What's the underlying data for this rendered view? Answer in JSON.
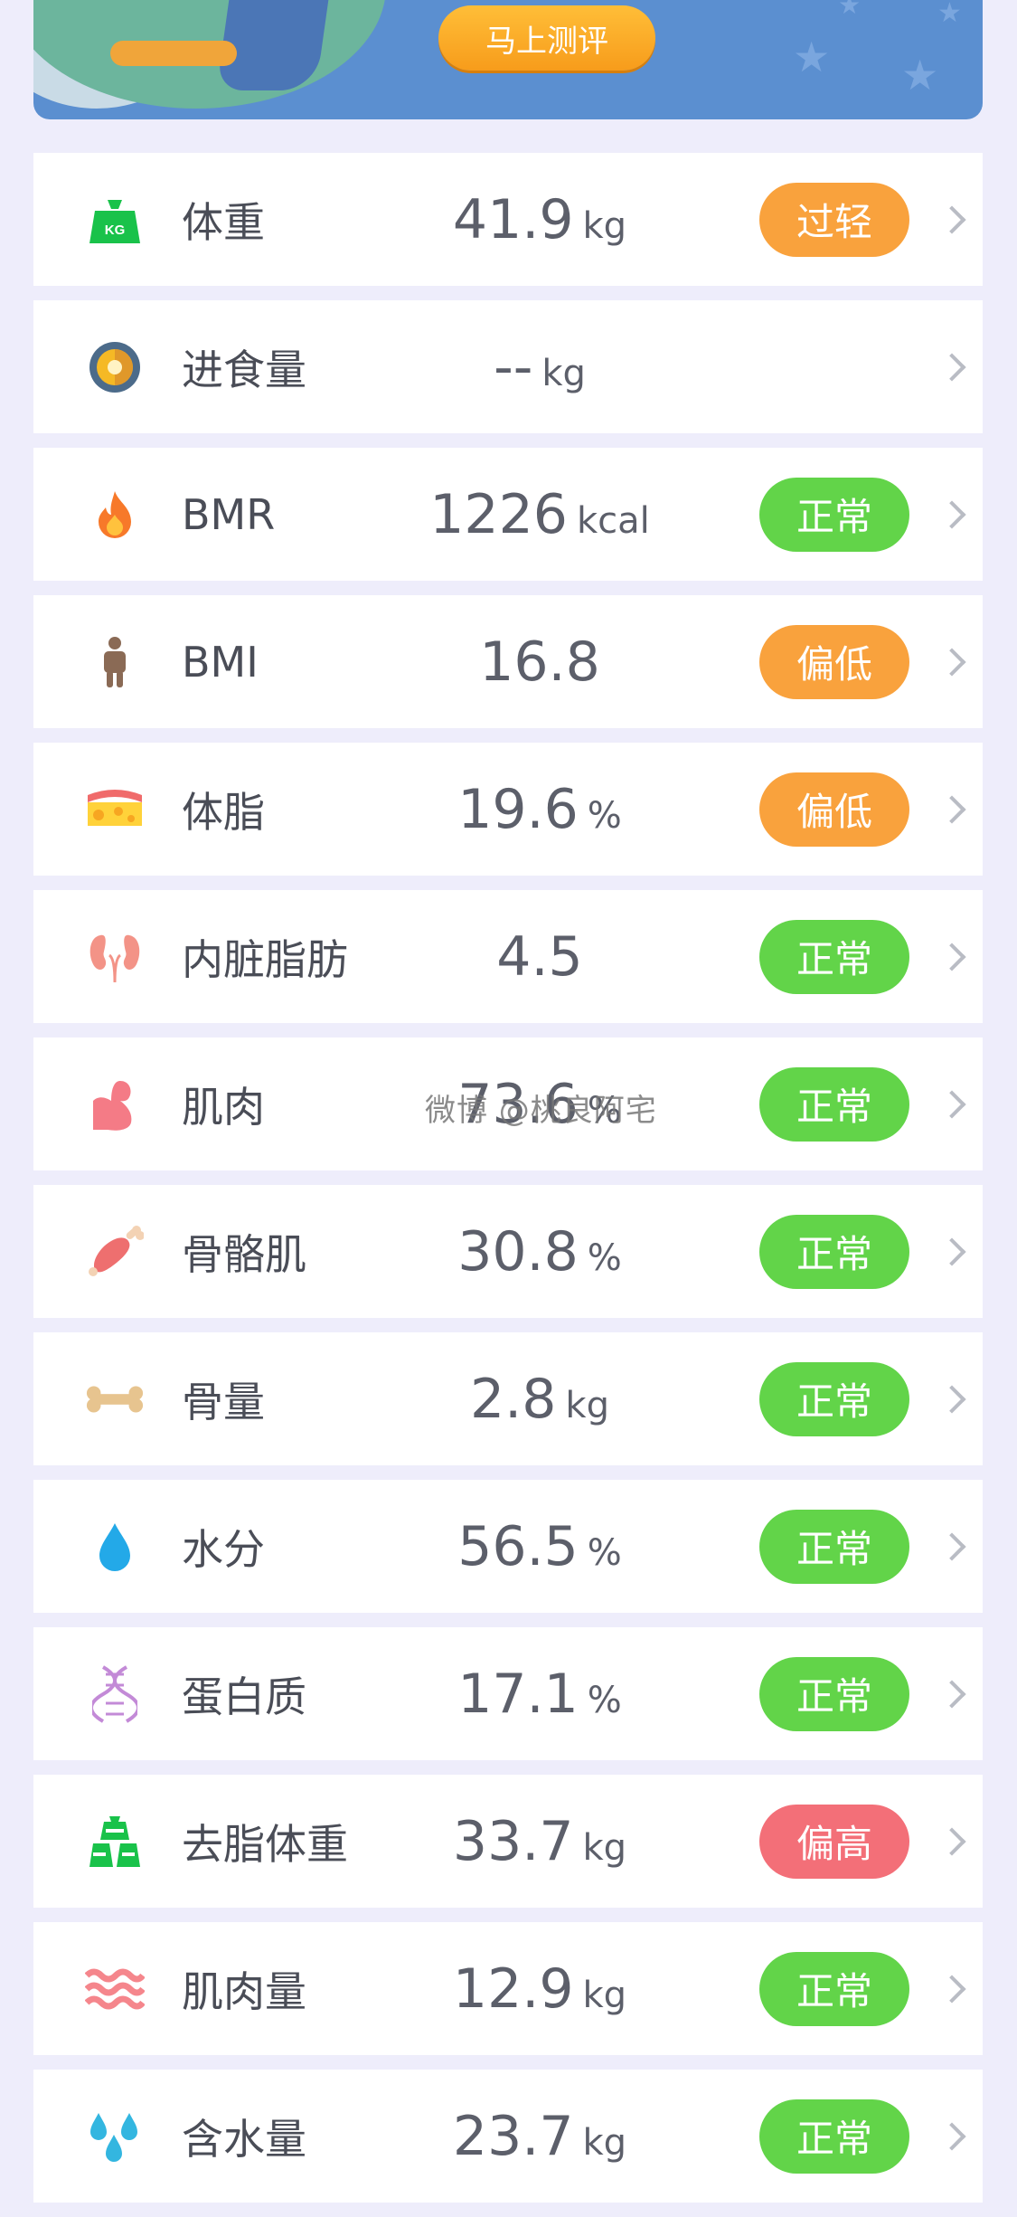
{
  "banner": {
    "button_label": "马上测评"
  },
  "colors": {
    "orange": "#f9a23d",
    "green": "#62d449",
    "red": "#f36f78"
  },
  "metrics": [
    {
      "label": "体重",
      "value": "41.9",
      "unit": "kg",
      "status": "过轻",
      "status_color": "#f9a23d",
      "icon": "kg-weight-icon"
    },
    {
      "label": "进食量",
      "value": "--",
      "unit": "kg",
      "status": "",
      "status_color": "",
      "icon": "food-plate-icon"
    },
    {
      "label": "BMR",
      "value": "1226",
      "unit": "kcal",
      "status": "正常",
      "status_color": "#62d449",
      "icon": "flame-icon"
    },
    {
      "label": "BMI",
      "value": "16.8",
      "unit": "",
      "status": "偏低",
      "status_color": "#f9a23d",
      "icon": "person-icon"
    },
    {
      "label": "体脂",
      "value": "19.6",
      "unit": "%",
      "status": "偏低",
      "status_color": "#f9a23d",
      "icon": "fat-layer-icon"
    },
    {
      "label": "内脏脂肪",
      "value": "4.5",
      "unit": "",
      "status": "正常",
      "status_color": "#62d449",
      "icon": "kidney-icon"
    },
    {
      "label": "肌肉",
      "value": "73.6",
      "unit": "%",
      "status": "正常",
      "status_color": "#62d449",
      "icon": "bicep-icon"
    },
    {
      "label": "骨骼肌",
      "value": "30.8",
      "unit": "%",
      "status": "正常",
      "status_color": "#62d449",
      "icon": "meat-bone-icon"
    },
    {
      "label": "骨量",
      "value": "2.8",
      "unit": "kg",
      "status": "正常",
      "status_color": "#62d449",
      "icon": "bone-icon"
    },
    {
      "label": "水分",
      "value": "56.5",
      "unit": "%",
      "status": "正常",
      "status_color": "#62d449",
      "icon": "water-drop-icon"
    },
    {
      "label": "蛋白质",
      "value": "17.1",
      "unit": "%",
      "status": "正常",
      "status_color": "#62d449",
      "icon": "dna-icon"
    },
    {
      "label": "去脂体重",
      "value": "33.7",
      "unit": "kg",
      "status": "偏高",
      "status_color": "#f36f78",
      "icon": "weights-icon"
    },
    {
      "label": "肌肉量",
      "value": "12.9",
      "unit": "kg",
      "status": "正常",
      "status_color": "#62d449",
      "icon": "muscle-waves-icon"
    },
    {
      "label": "含水量",
      "value": "23.7",
      "unit": "kg",
      "status": "正常",
      "status_color": "#62d449",
      "icon": "water-drops-icon"
    }
  ],
  "watermark": "微博 @桃良阿宅"
}
